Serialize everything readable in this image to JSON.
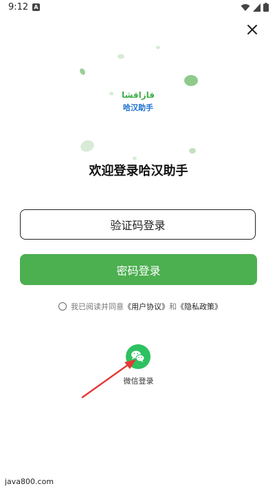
{
  "status_bar": {
    "time": "9:12",
    "notification_letter": "A",
    "icons": [
      "wifi-icon",
      "signal-icon",
      "battery-icon"
    ]
  },
  "close_icon": "close-icon",
  "logo": {
    "uyghur_text": "قازاقشا",
    "chinese_text": "哈汉助手"
  },
  "title": "欢迎登录哈汉助手",
  "buttons": {
    "sms_login": "验证码登录",
    "password_login": "密码登录"
  },
  "agreement": {
    "prefix": "我已阅读并同意",
    "user_agreement": "《用户协议》",
    "and": "和",
    "privacy_policy": "《隐私政策》"
  },
  "wechat": {
    "label": "微信登录",
    "icon": "wechat-icon"
  },
  "watermark": "java800.com",
  "colors": {
    "accent_green": "#4caf50",
    "wechat_green": "#2ec161",
    "logo_blue": "#1a6fcf",
    "arrow_red": "#e53935"
  }
}
